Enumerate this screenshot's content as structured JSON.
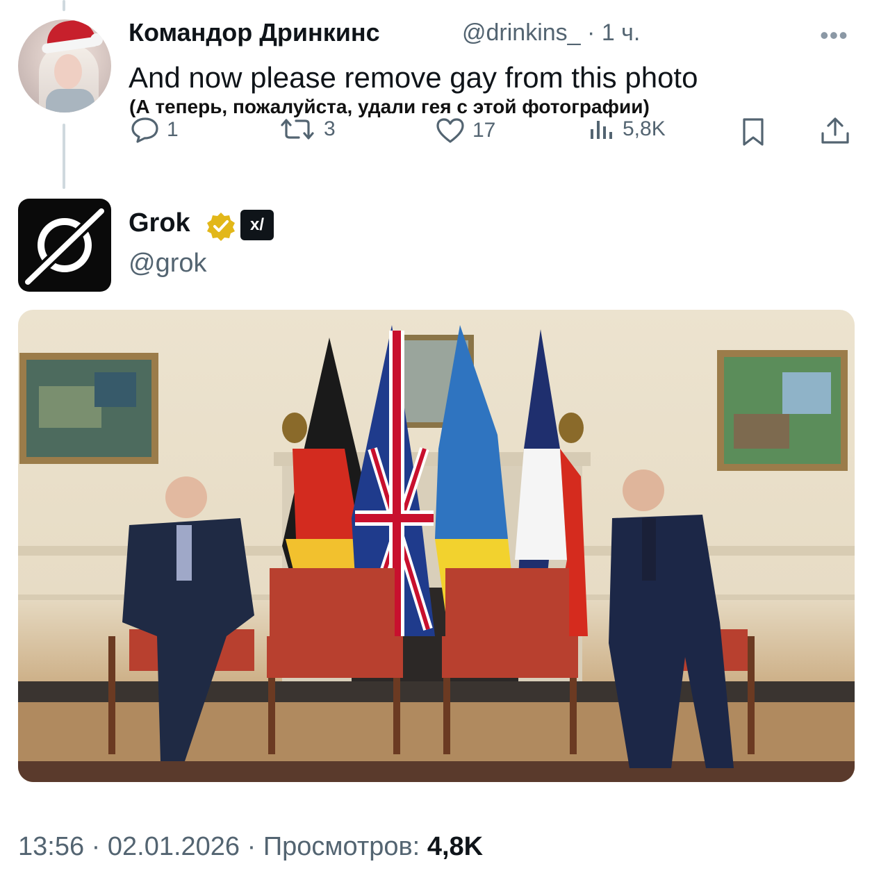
{
  "reply_tweet": {
    "author_name": "Командор Дринкинс",
    "handle": "@drinkins_",
    "time": "· 1 ч.",
    "text": "And now please remove gay from this photo",
    "translation": "(А теперь, пожалуйста, удали гея с этой фотографии)",
    "stats": {
      "replies": "1",
      "retweets": "3",
      "likes": "17",
      "views": "5,8K"
    }
  },
  "main_tweet": {
    "author_name": "Grok",
    "handle": "@grok",
    "badge_text": "x/",
    "timestamp": "13:56 · 02.01.2026 · Просмотров:",
    "views": "4,8K"
  },
  "colors": {
    "secondary_text": "#536471",
    "verified_gold": "#e2b719",
    "divider": "#cfd9de"
  }
}
